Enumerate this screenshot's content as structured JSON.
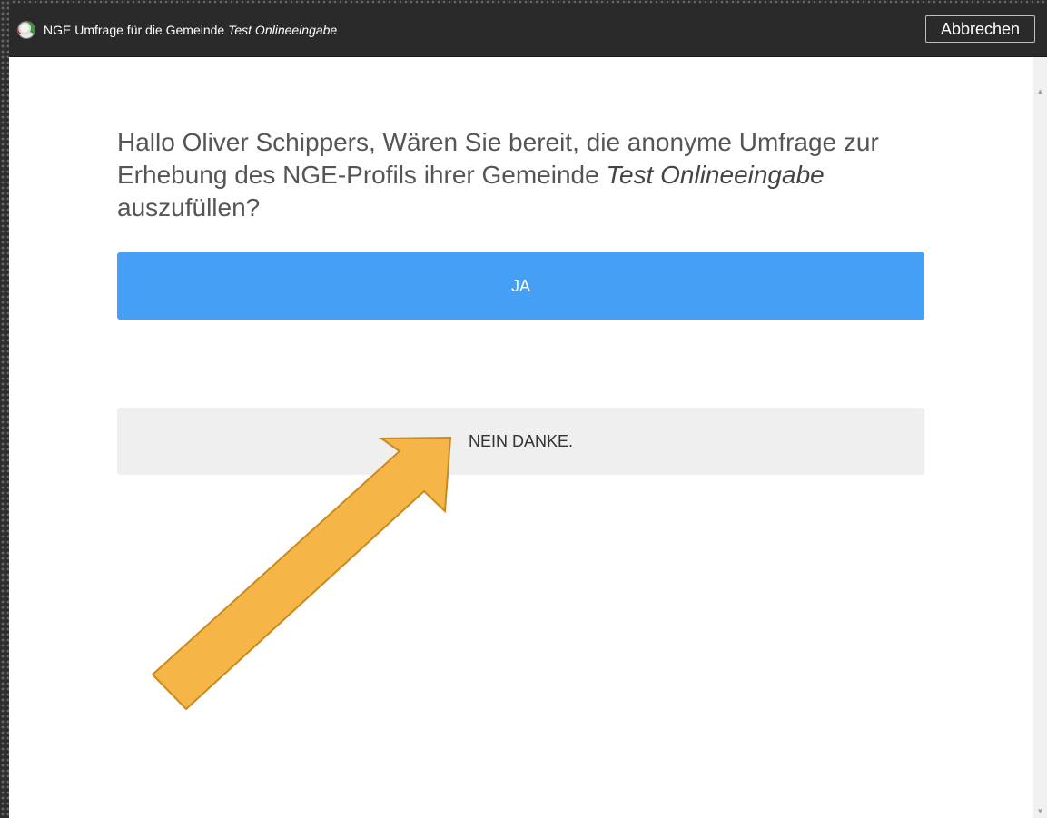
{
  "window": {
    "title_prefix": "NGE Umfrage für die Gemeinde ",
    "title_municipality": "Test Onlineeingabe",
    "cancel_label": "Abbrechen",
    "icon": "globe-icon"
  },
  "question": {
    "line_text": "Hallo Oliver Schippers, Wären Sie bereit, die anonyme Umfrage zur Erhebung des NGE-Profils ihrer Gemeinde ",
    "municipality": "Test Onlineeingabe",
    "suffix": " auszufüllen?"
  },
  "buttons": {
    "yes_label": "JA",
    "no_label": "NEIN DANKE."
  },
  "colors": {
    "primary": "#45a0f5",
    "secondary": "#efefef",
    "titlebar": "#2a2a2a",
    "annotation_arrow": "#f5b547"
  },
  "scrollbar": {
    "up_icon": "▲",
    "down_icon": "▼"
  }
}
